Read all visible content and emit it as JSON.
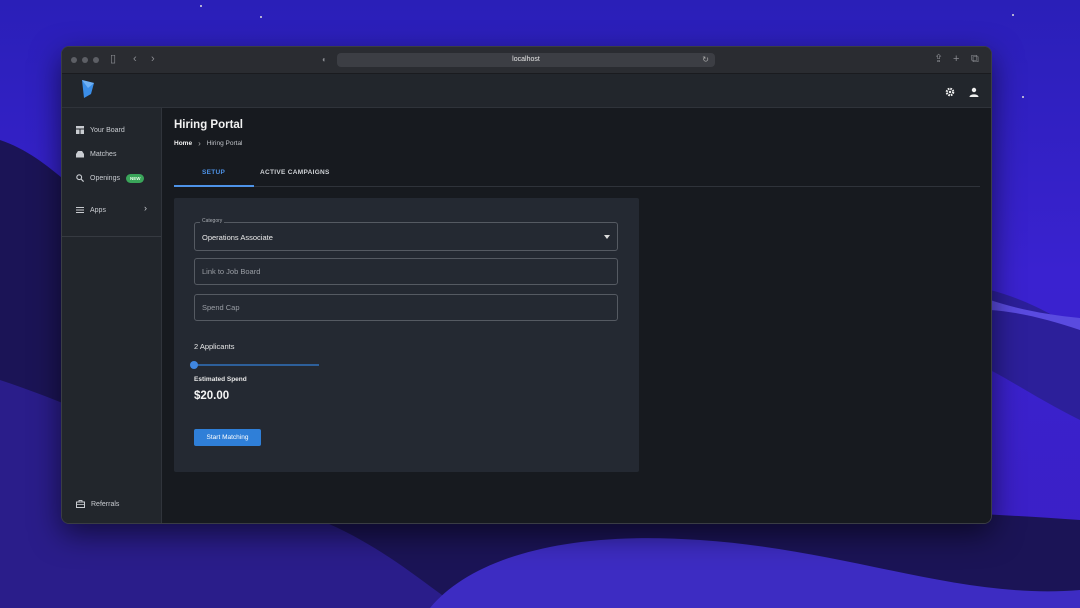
{
  "browser": {
    "url": "localhost"
  },
  "sidebar": {
    "items": [
      {
        "label": "Your Board",
        "icon": "board-icon"
      },
      {
        "label": "Matches",
        "icon": "inbox-icon"
      },
      {
        "label": "Openings",
        "icon": "search-icon",
        "badge": "NEW"
      },
      {
        "label": "Apps",
        "icon": "menu-icon"
      }
    ],
    "footer": {
      "label": "Referrals",
      "icon": "briefcase-icon"
    }
  },
  "header": {
    "title": "Hiring Portal",
    "breadcrumb": {
      "home": "Home",
      "current": "Hiring Portal"
    }
  },
  "tabs": [
    {
      "label": "SETUP",
      "active": true
    },
    {
      "label": "ACTIVE CAMPAIGNS",
      "active": false
    }
  ],
  "form": {
    "category": {
      "legend": "Category",
      "value": "Operations Associate"
    },
    "job_board": {
      "placeholder": "Link to Job Board"
    },
    "spend_cap": {
      "placeholder": "Spend Cap"
    },
    "applicants_label": "2 Applicants",
    "slider_fraction": 0.0,
    "estimated_label": "Estimated Spend",
    "estimated_value": "$20.00",
    "submit_label": "Start Matching"
  },
  "colors": {
    "accent": "#4e93e8",
    "badge": "#3aa55a",
    "button": "#2f7fd8"
  }
}
